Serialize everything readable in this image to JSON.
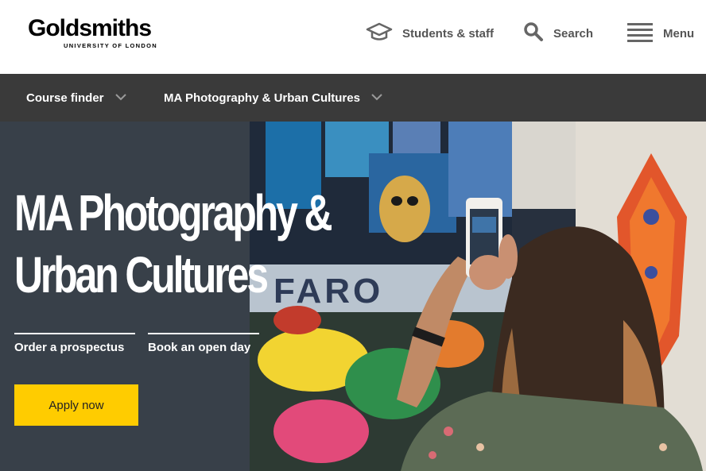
{
  "brand": {
    "name": "Goldsmiths",
    "subtitle": "UNIVERSITY OF LONDON"
  },
  "header": {
    "students_staff": {
      "label": "Students & staff",
      "icon": "graduation-cap-icon"
    },
    "search": {
      "label": "Search",
      "icon": "search-icon"
    },
    "menu": {
      "label": "Menu",
      "icon": "hamburger-menu-icon"
    }
  },
  "nav": {
    "items": [
      {
        "label": "Course finder",
        "icon": "chevron-down-icon"
      },
      {
        "label": "MA Photography & Urban Cultures",
        "icon": "chevron-down-icon"
      }
    ]
  },
  "hero": {
    "title_line1": "MA Photography &",
    "title_line2": "Urban Cultures",
    "links": [
      {
        "label": "Order a prospectus"
      },
      {
        "label": "Book an open day"
      }
    ],
    "apply_label": "Apply now",
    "photo": "woman-photographing-graffiti-with-phone"
  },
  "colors": {
    "navbar_bg": "#3a3a3a",
    "hero_panel_bg": "#384049",
    "apply_bg": "#ffcc00",
    "header_text": "#555555"
  }
}
